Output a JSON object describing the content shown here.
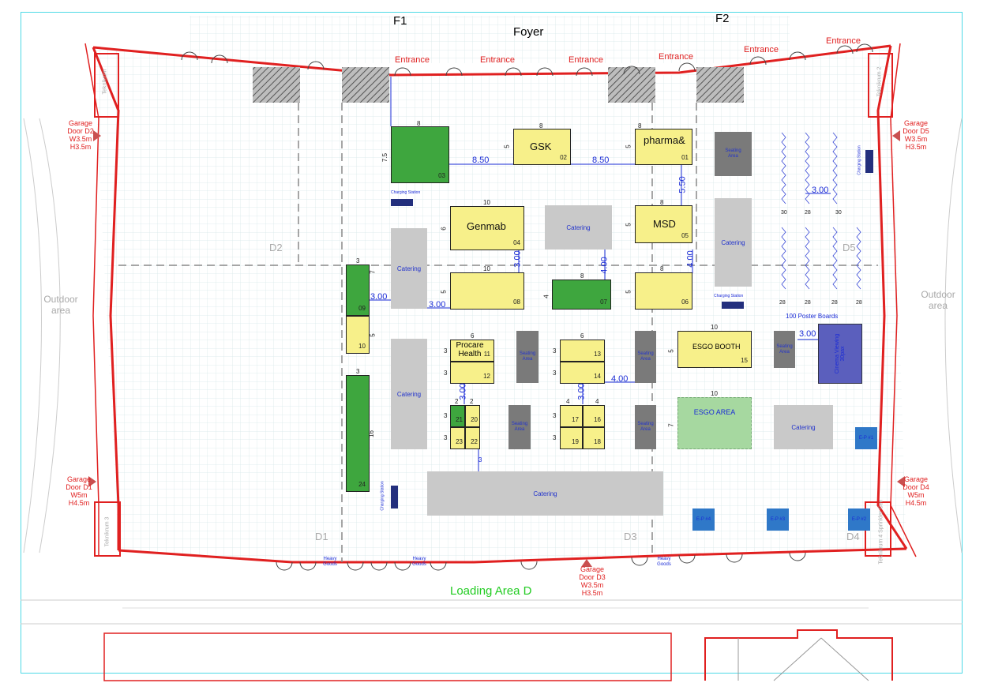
{
  "colors": {
    "booth_yellow": "#f7f08a",
    "booth_green": "#3ea63e",
    "catering": "#c9c9c9",
    "seating": "#7a7a7a",
    "charging": "#232f7d",
    "wall_red": "#e02020",
    "grid": "#d8e9ea",
    "dim_blue": "#1a2bd6",
    "loading_green": "#22cc22",
    "frame_cyan": "#4dd9e6",
    "esgo_area": "#a6d8a0",
    "cinema": "#5b5fbd"
  },
  "header": {
    "f1": "F1",
    "foyer": "Foyer",
    "f2": "F2"
  },
  "entrance_label": "Entrance",
  "zones": {
    "d1": "D1",
    "d2": "D2",
    "d3": "D3",
    "d4": "D4",
    "d5": "D5"
  },
  "outdoor": "Outdoor area",
  "loading": "Loading Area D",
  "technical": {
    "t1": "Teknikrum",
    "t2": "Teknikrum 2",
    "t3": "Teknikrum 3",
    "t4": "Teknikrum 4 Sprinkler Cen"
  },
  "garage_doors": {
    "d2": [
      "Garage",
      "Door D2",
      "W3.5m",
      "H3.5m"
    ],
    "d5": [
      "Garage",
      "Door D5",
      "W3.5m",
      "H3.5m"
    ],
    "d1": [
      "Garage",
      "Door D1",
      "W5m",
      "H4.5m"
    ],
    "d4": [
      "Garage",
      "Door D4",
      "W5m",
      "H4.5m"
    ],
    "d3": [
      "Garage",
      "Door D3",
      "W3.5m",
      "H3.5m"
    ]
  },
  "heavy_goods": "Heavy Goods",
  "booths": {
    "b01": {
      "name": "pharma&",
      "num": "01",
      "w": "8",
      "d": "5"
    },
    "b02": {
      "name": "GSK",
      "num": "02",
      "w": "8",
      "d": "5"
    },
    "b03": {
      "num": "03",
      "w": "8",
      "d": "7.5"
    },
    "b04": {
      "name": "Genmab",
      "num": "04",
      "w": "10",
      "d": "6"
    },
    "b05": {
      "name": "MSD",
      "num": "05",
      "w": "8",
      "d": "5"
    },
    "b06": {
      "num": "06",
      "w": "8",
      "d": "5"
    },
    "b07": {
      "num": "07",
      "w": "8",
      "d": "4"
    },
    "b08": {
      "num": "08",
      "w": "10",
      "d": "5"
    },
    "b09": {
      "num": "09",
      "w": "3",
      "d": "7"
    },
    "b10": {
      "num": "10",
      "d": "5"
    },
    "b11": {
      "name": "Procare Health",
      "num": "11",
      "w": "6",
      "d": "3"
    },
    "b12": {
      "num": "12",
      "d": "3"
    },
    "b13": {
      "num": "13",
      "w": "6",
      "d": "3"
    },
    "b14": {
      "num": "14",
      "d": "3"
    },
    "b15": {
      "name": "ESGO BOOTH",
      "num": "15",
      "w": "10",
      "d": "5"
    },
    "b16": {
      "num": "16",
      "w": "4"
    },
    "b17": {
      "num": "17",
      "w": "4",
      "d": "3"
    },
    "b18": {
      "num": "18"
    },
    "b19": {
      "num": "19",
      "d": "3"
    },
    "b20": {
      "num": "20",
      "w": "2"
    },
    "b21": {
      "num": "21",
      "w": "2",
      "d": "3"
    },
    "b22": {
      "num": "22"
    },
    "b23": {
      "num": "23",
      "d": "3"
    },
    "b24": {
      "num": "24",
      "w": "3",
      "d": "16"
    }
  },
  "esgo_area": {
    "name": "ESGO AREA",
    "w": "10",
    "d": "7"
  },
  "cinema": "Cinema Viewing 30pax",
  "catering_label": "Catering",
  "seating_label": "Seating Area",
  "charging_label": "Charging Station",
  "poster_boards": "100 Poster Boards",
  "poster_counts": [
    "30",
    "28",
    "30",
    "28",
    "28",
    "28",
    "28"
  ],
  "ep_labels": [
    "E-P #1",
    "E-P #2",
    "E-P #3",
    "E-P #4"
  ],
  "dims": {
    "d850a": "8.50",
    "d850b": "8.50",
    "d550": "5.50",
    "d300a": "3.00",
    "d300b": "3.00",
    "d300c": "3.00",
    "d400a": "4.00",
    "d400b": "4.00",
    "d400c": "4.00",
    "d300d": "3.00",
    "d300e": "3.00",
    "d300f": "3.00",
    "d300g": "3.00",
    "d3": "3"
  }
}
